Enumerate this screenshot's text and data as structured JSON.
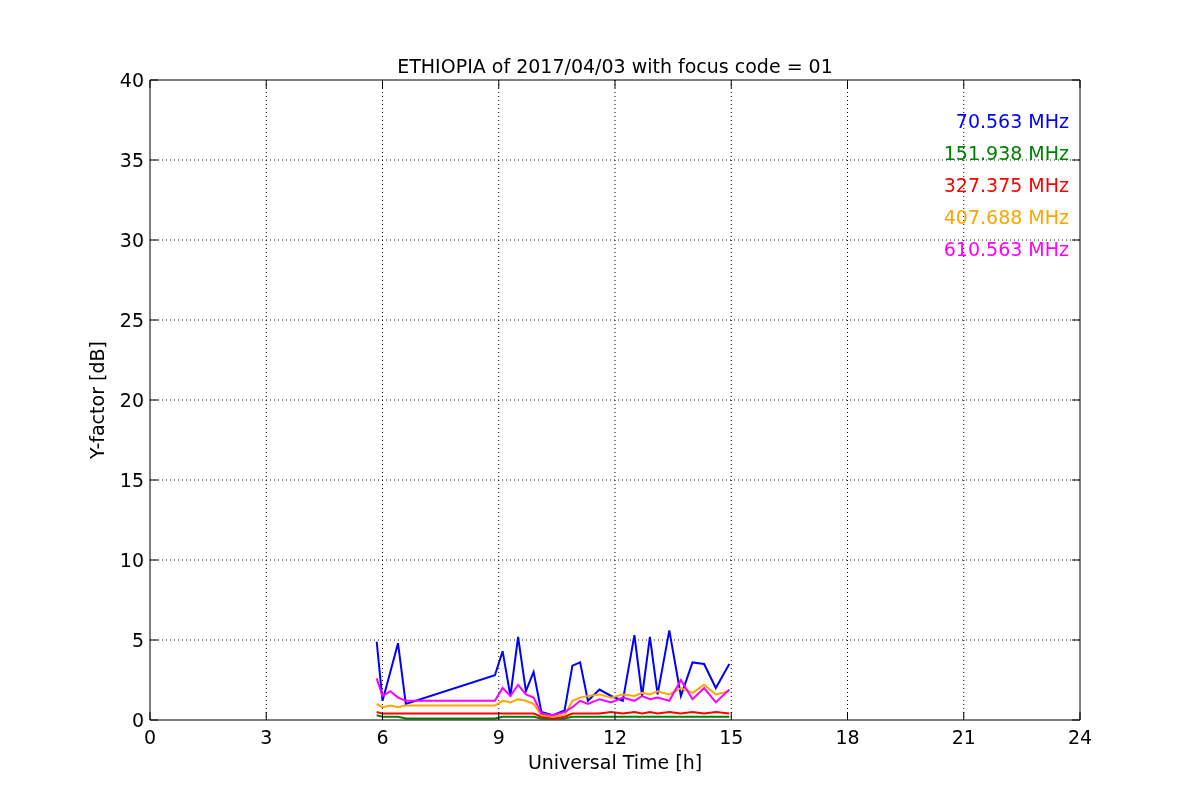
{
  "chart_data": {
    "type": "line",
    "title": "ETHIOPIA of 2017/04/03 with focus code = 01",
    "xlabel": "Universal Time [h]",
    "ylabel": "Y-factor [dB]",
    "grid": true,
    "xlim": [
      0,
      24
    ],
    "ylim": [
      0,
      40
    ],
    "xticks": [
      0,
      3,
      6,
      9,
      12,
      15,
      18,
      21,
      24
    ],
    "yticks": [
      0,
      5,
      10,
      15,
      20,
      25,
      30,
      35,
      40
    ],
    "x": [
      5.85,
      6.0,
      6.2,
      6.4,
      6.6,
      8.9,
      9.1,
      9.3,
      9.5,
      9.7,
      9.9,
      10.1,
      10.4,
      10.7,
      10.9,
      11.1,
      11.3,
      11.6,
      11.9,
      12.2,
      12.5,
      12.7,
      12.9,
      13.1,
      13.4,
      13.7,
      14.0,
      14.3,
      14.6,
      14.95
    ],
    "series": [
      {
        "name": "70.563 MHz",
        "color": "#0000ff",
        "values": [
          4.9,
          1.2,
          3.0,
          4.8,
          1.0,
          2.8,
          4.3,
          1.5,
          5.2,
          1.8,
          3.0,
          0.5,
          0.3,
          0.6,
          3.4,
          3.6,
          1.2,
          1.9,
          1.5,
          1.2,
          5.3,
          1.5,
          5.2,
          1.6,
          5.6,
          1.5,
          3.6,
          3.5,
          2.0,
          3.5
        ]
      },
      {
        "name": "151.938 MHz",
        "color": "#008000",
        "values": [
          0.3,
          0.2,
          0.2,
          0.2,
          0.1,
          0.1,
          0.2,
          0.2,
          0.2,
          0.2,
          0.2,
          0.1,
          0.1,
          0.1,
          0.2,
          0.2,
          0.2,
          0.2,
          0.2,
          0.2,
          0.2,
          0.2,
          0.2,
          0.2,
          0.2,
          0.2,
          0.2,
          0.2,
          0.2,
          0.2
        ]
      },
      {
        "name": "327.375 MHz",
        "color": "#ff0000",
        "values": [
          0.5,
          0.4,
          0.4,
          0.4,
          0.4,
          0.4,
          0.4,
          0.4,
          0.4,
          0.4,
          0.4,
          0.2,
          0.1,
          0.2,
          0.4,
          0.4,
          0.4,
          0.4,
          0.5,
          0.4,
          0.5,
          0.4,
          0.5,
          0.4,
          0.5,
          0.4,
          0.5,
          0.4,
          0.5,
          0.4
        ]
      },
      {
        "name": "407.688 MHz",
        "color": "#ffa500",
        "values": [
          1.0,
          0.8,
          0.9,
          0.8,
          0.9,
          0.9,
          1.2,
          1.1,
          1.3,
          1.2,
          1.0,
          0.3,
          0.2,
          0.3,
          1.2,
          1.4,
          1.5,
          1.6,
          1.4,
          1.6,
          1.5,
          1.7,
          1.6,
          1.8,
          1.6,
          2.0,
          1.7,
          2.2,
          1.6,
          1.8
        ]
      },
      {
        "name": "610.563 MHz",
        "color": "#ff00ff",
        "values": [
          2.6,
          1.5,
          1.8,
          1.4,
          1.2,
          1.2,
          2.0,
          1.5,
          2.2,
          1.6,
          1.4,
          0.4,
          0.3,
          0.5,
          0.8,
          1.2,
          1.0,
          1.3,
          1.1,
          1.4,
          1.2,
          1.5,
          1.3,
          1.4,
          1.2,
          2.5,
          1.3,
          2.0,
          1.1,
          1.9
        ]
      }
    ]
  }
}
